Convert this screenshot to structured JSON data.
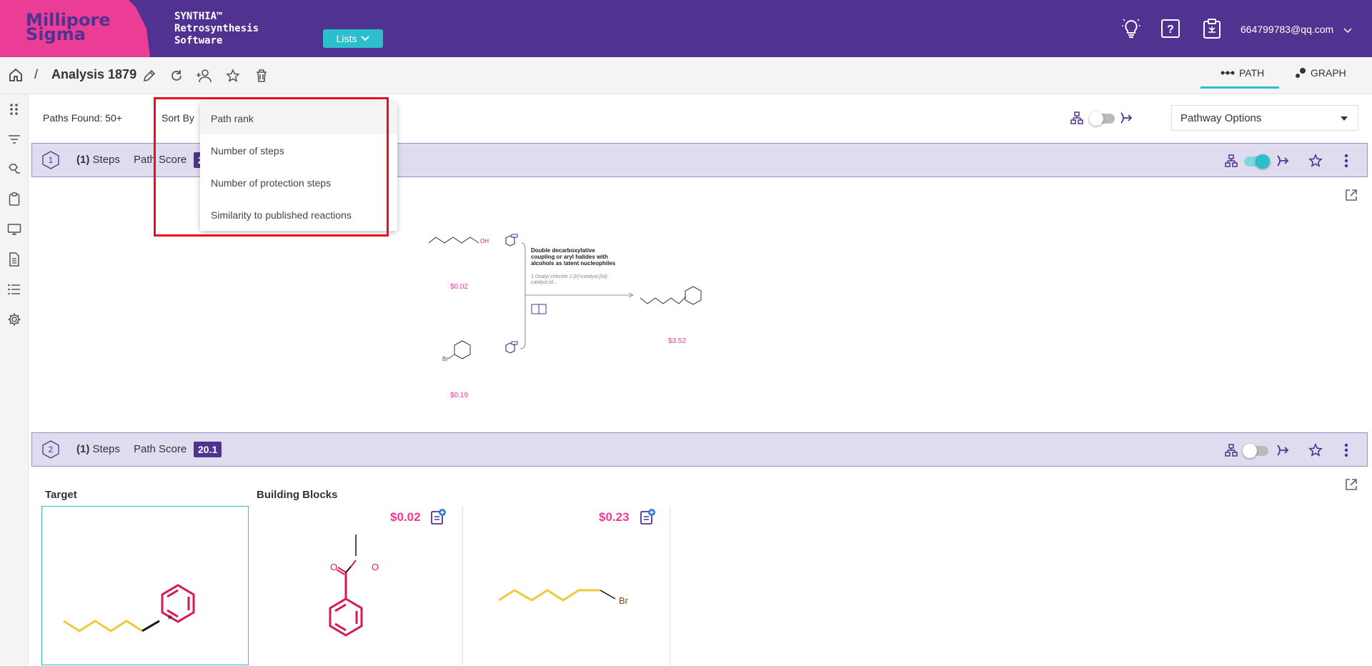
{
  "header": {
    "logo_line1": "Millipore",
    "logo_line2": "Sigma",
    "brand_lines": [
      "SYNTHIA™",
      "Retrosynthesis",
      "Software"
    ],
    "lists_label": "Lists",
    "user_email": "664799783@qq.com"
  },
  "breadcrumb": {
    "separator": "/",
    "title": "Analysis 1879"
  },
  "view_tabs": {
    "path_label": "PATH",
    "graph_label": "GRAPH"
  },
  "controls": {
    "paths_found": "Paths Found: 50+",
    "sort_by_label": "Sort By",
    "pathway_options_label": "Pathway Options"
  },
  "sort_menu": {
    "items": [
      "Path rank",
      "Number of steps",
      "Number of protection steps",
      "Similarity to published reactions"
    ],
    "selected": "Path rank"
  },
  "paths": [
    {
      "number": "1",
      "steps_count": "(1)",
      "steps_label": "Steps",
      "score_label": "Path Score",
      "score": "2",
      "toggle_on": true,
      "diagram": {
        "reactant1_label": "OH",
        "reactant1_price": "$0.02",
        "reactant2_label": "Br",
        "reactant2_price": "$0.19",
        "product_price": "$3.52",
        "reaction_name": "Double decarboxylative coupling or aryl halides with alcohols as latent nucleophiles",
        "reaction_conditions": "1.Oxalyl chloride 2.[Ir]-catalyst,[Ni]-catalyst,bl..."
      }
    },
    {
      "number": "2",
      "steps_count": "(1)",
      "steps_label": "Steps",
      "score_label": "Path Score",
      "score": "20.1",
      "toggle_on": false,
      "target_label": "Target",
      "building_blocks_label": "Building Blocks",
      "target_bond_mark": "#",
      "building_blocks": [
        {
          "price": "$0.02",
          "atom_labels": [
            "O",
            "O"
          ]
        },
        {
          "price": "$0.23",
          "atom_labels": [
            "Br"
          ]
        }
      ]
    }
  ],
  "colors": {
    "header_purple": "#503291",
    "brand_pink": "#eb3c96",
    "accent_teal": "#2dbecd",
    "row_lavender": "#e0dcef",
    "highlight_red": "#e8101d",
    "chain_yellow": "#f2c83c",
    "ring_pink": "#d9184f"
  },
  "icons": {
    "header": [
      "lightbulb-icon",
      "help-icon",
      "clipboard-icon",
      "chevron-down-icon"
    ],
    "toolbar": [
      "home-icon",
      "edit-icon",
      "refresh-icon",
      "add-user-icon",
      "star-icon",
      "trash-icon"
    ],
    "rail": [
      "apps-icon",
      "filter-icon",
      "reaction-icon",
      "clipboard-icon",
      "monitor-icon",
      "document-icon",
      "list-icon",
      "settings-icon"
    ]
  }
}
